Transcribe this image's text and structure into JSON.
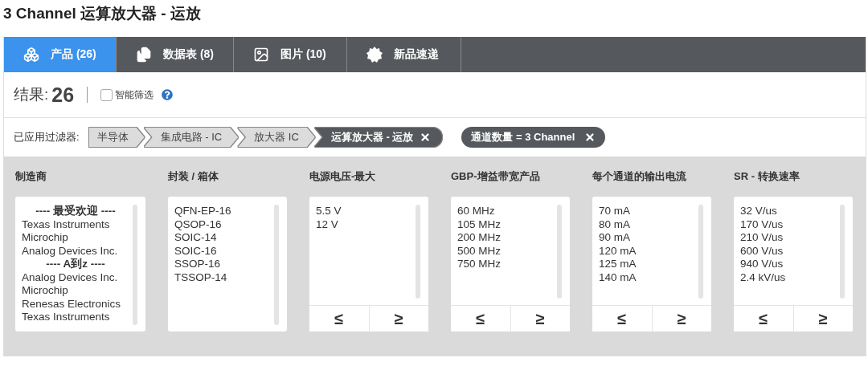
{
  "page_title": "3 Channel 运算放大器 - 运放",
  "tabs": [
    {
      "label": "产品 (26)",
      "kind": "cubes",
      "selected": true
    },
    {
      "label": "数据表 (8)",
      "kind": "files",
      "selected": false
    },
    {
      "label": "图片 (10)",
      "kind": "image",
      "selected": false
    },
    {
      "label": "新品速递",
      "kind": "new",
      "selected": false
    }
  ],
  "results": {
    "label": "结果:",
    "count": "26",
    "smart_filter": {
      "label": "智能筛选",
      "checked": false
    }
  },
  "applied_filters": {
    "label": "已应用过滤器:",
    "breadcrumbs": [
      {
        "label": "半导体",
        "selected": false
      },
      {
        "label": "集成电路 - IC",
        "selected": false
      },
      {
        "label": "放大器 IC",
        "selected": false
      },
      {
        "label": "运算放大器 - 运放",
        "selected": true
      }
    ],
    "chips": [
      "通道数量 = 3 Channel"
    ]
  },
  "filters": [
    {
      "title": "制造商",
      "items": [
        {
          "kind": "header",
          "text": "---- 最受欢迎 ----"
        },
        {
          "kind": "option",
          "text": "Texas Instruments"
        },
        {
          "kind": "option",
          "text": "Microchip"
        },
        {
          "kind": "option",
          "text": "Analog Devices Inc."
        },
        {
          "kind": "header",
          "text": "---- A到z ----"
        },
        {
          "kind": "option",
          "text": "Analog Devices Inc."
        },
        {
          "kind": "option",
          "text": "Microchip"
        },
        {
          "kind": "option",
          "text": "Renesas Electronics"
        },
        {
          "kind": "option",
          "text": "Texas Instruments"
        }
      ]
    },
    {
      "title": "封装 / 箱体",
      "items": [
        {
          "kind": "option",
          "text": "QFN-EP-16"
        },
        {
          "kind": "option",
          "text": "QSOP-16"
        },
        {
          "kind": "option",
          "text": "SOIC-14"
        },
        {
          "kind": "option",
          "text": "SOIC-16"
        },
        {
          "kind": "option",
          "text": "SSOP-16"
        },
        {
          "kind": "option",
          "text": "TSSOP-14"
        }
      ]
    },
    {
      "title": "电源电压-最大",
      "items": [
        {
          "kind": "option",
          "text": "5.5 V"
        },
        {
          "kind": "option",
          "text": "12 V"
        }
      ],
      "compare": [
        "≤",
        "≥"
      ]
    },
    {
      "title": "GBP-增益带宽产品",
      "items": [
        {
          "kind": "option",
          "text": "60 MHz"
        },
        {
          "kind": "option",
          "text": "105 MHz"
        },
        {
          "kind": "option",
          "text": "200 MHz"
        },
        {
          "kind": "option",
          "text": "500 MHz"
        },
        {
          "kind": "option",
          "text": "750 MHz"
        }
      ],
      "compare": [
        "≤",
        "≥"
      ]
    },
    {
      "title": "每个通道的输出电流",
      "items": [
        {
          "kind": "option",
          "text": "70 mA"
        },
        {
          "kind": "option",
          "text": "80 mA"
        },
        {
          "kind": "option",
          "text": "90 mA"
        },
        {
          "kind": "option",
          "text": "120 mA"
        },
        {
          "kind": "option",
          "text": "125 mA"
        },
        {
          "kind": "option",
          "text": "140 mA"
        }
      ],
      "compare": [
        "≤",
        "≥"
      ]
    },
    {
      "title": "SR - 转换速率",
      "items": [
        {
          "kind": "option",
          "text": "32 V/us"
        },
        {
          "kind": "option",
          "text": "170 V/us"
        },
        {
          "kind": "option",
          "text": "210 V/us"
        },
        {
          "kind": "option",
          "text": "600 V/us"
        },
        {
          "kind": "option",
          "text": "940 V/us"
        },
        {
          "kind": "option",
          "text": "2.4 kV/us"
        }
      ],
      "compare": [
        "≤",
        "≥"
      ]
    }
  ]
}
